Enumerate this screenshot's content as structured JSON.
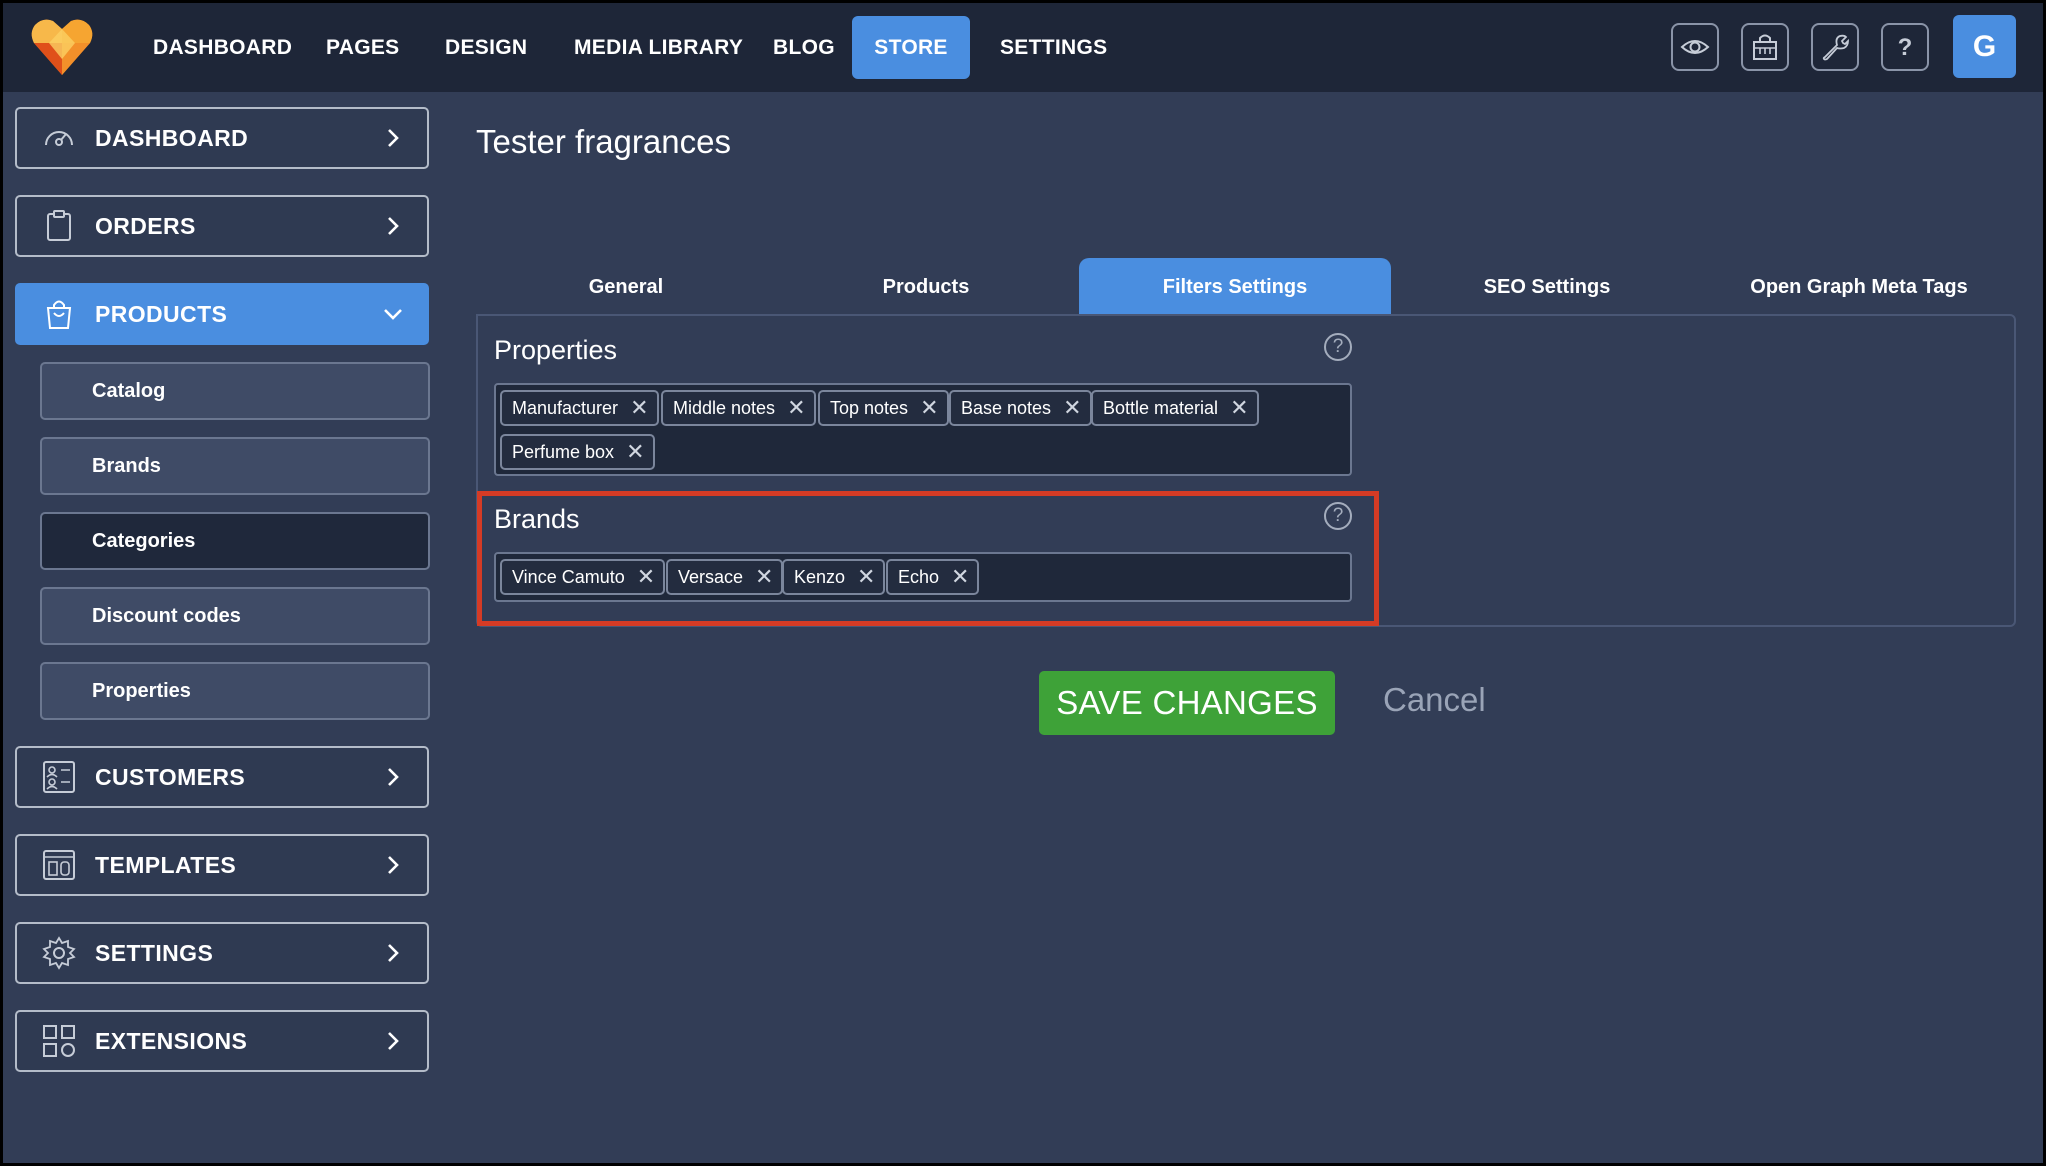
{
  "colors": {
    "accent": "#4a8ee0",
    "background": "#323d56",
    "topbar": "#1e2638",
    "save_green": "#3ea238",
    "highlight_red": "#d53b25"
  },
  "nav": {
    "items": [
      {
        "label": "DASHBOARD"
      },
      {
        "label": "PAGES"
      },
      {
        "label": "DESIGN"
      },
      {
        "label": "MEDIA LIBRARY"
      },
      {
        "label": "BLOG"
      },
      {
        "label": "STORE",
        "active": true
      },
      {
        "label": "SETTINGS"
      }
    ],
    "icons": [
      "eye-icon",
      "store-icon",
      "wrench-icon",
      "question-icon"
    ],
    "avatar": "G"
  },
  "sidebar": {
    "items": [
      {
        "label": "DASHBOARD",
        "icon": "gauge-icon"
      },
      {
        "label": "ORDERS",
        "icon": "clipboard-icon"
      },
      {
        "label": "PRODUCTS",
        "icon": "bag-icon",
        "active": true
      },
      {
        "label": "CUSTOMERS",
        "icon": "contacts-icon"
      },
      {
        "label": "TEMPLATES",
        "icon": "template-icon"
      },
      {
        "label": "SETTINGS",
        "icon": "gear-icon"
      },
      {
        "label": "EXTENSIONS",
        "icon": "extensions-icon"
      }
    ],
    "sub_items": [
      {
        "label": "Catalog"
      },
      {
        "label": "Brands"
      },
      {
        "label": "Categories",
        "selected": true
      },
      {
        "label": "Discount codes"
      },
      {
        "label": "Properties"
      }
    ]
  },
  "main": {
    "title": "Tester fragrances",
    "tabs": [
      {
        "label": "General"
      },
      {
        "label": "Products"
      },
      {
        "label": "Filters Settings",
        "active": true
      },
      {
        "label": "SEO Settings"
      },
      {
        "label": "Open Graph Meta Tags"
      }
    ],
    "properties": {
      "title": "Properties",
      "help": "?",
      "tags": [
        "Manufacturer",
        "Middle notes",
        "Top notes",
        "Base notes",
        "Bottle material",
        "Perfume box"
      ]
    },
    "brands": {
      "title": "Brands",
      "help": "?",
      "tags": [
        "Vince Camuto",
        "Versace",
        "Kenzo",
        "Echo"
      ]
    },
    "tag_remove": "✕",
    "save_label": "SAVE CHANGES",
    "cancel_label": "Cancel"
  }
}
